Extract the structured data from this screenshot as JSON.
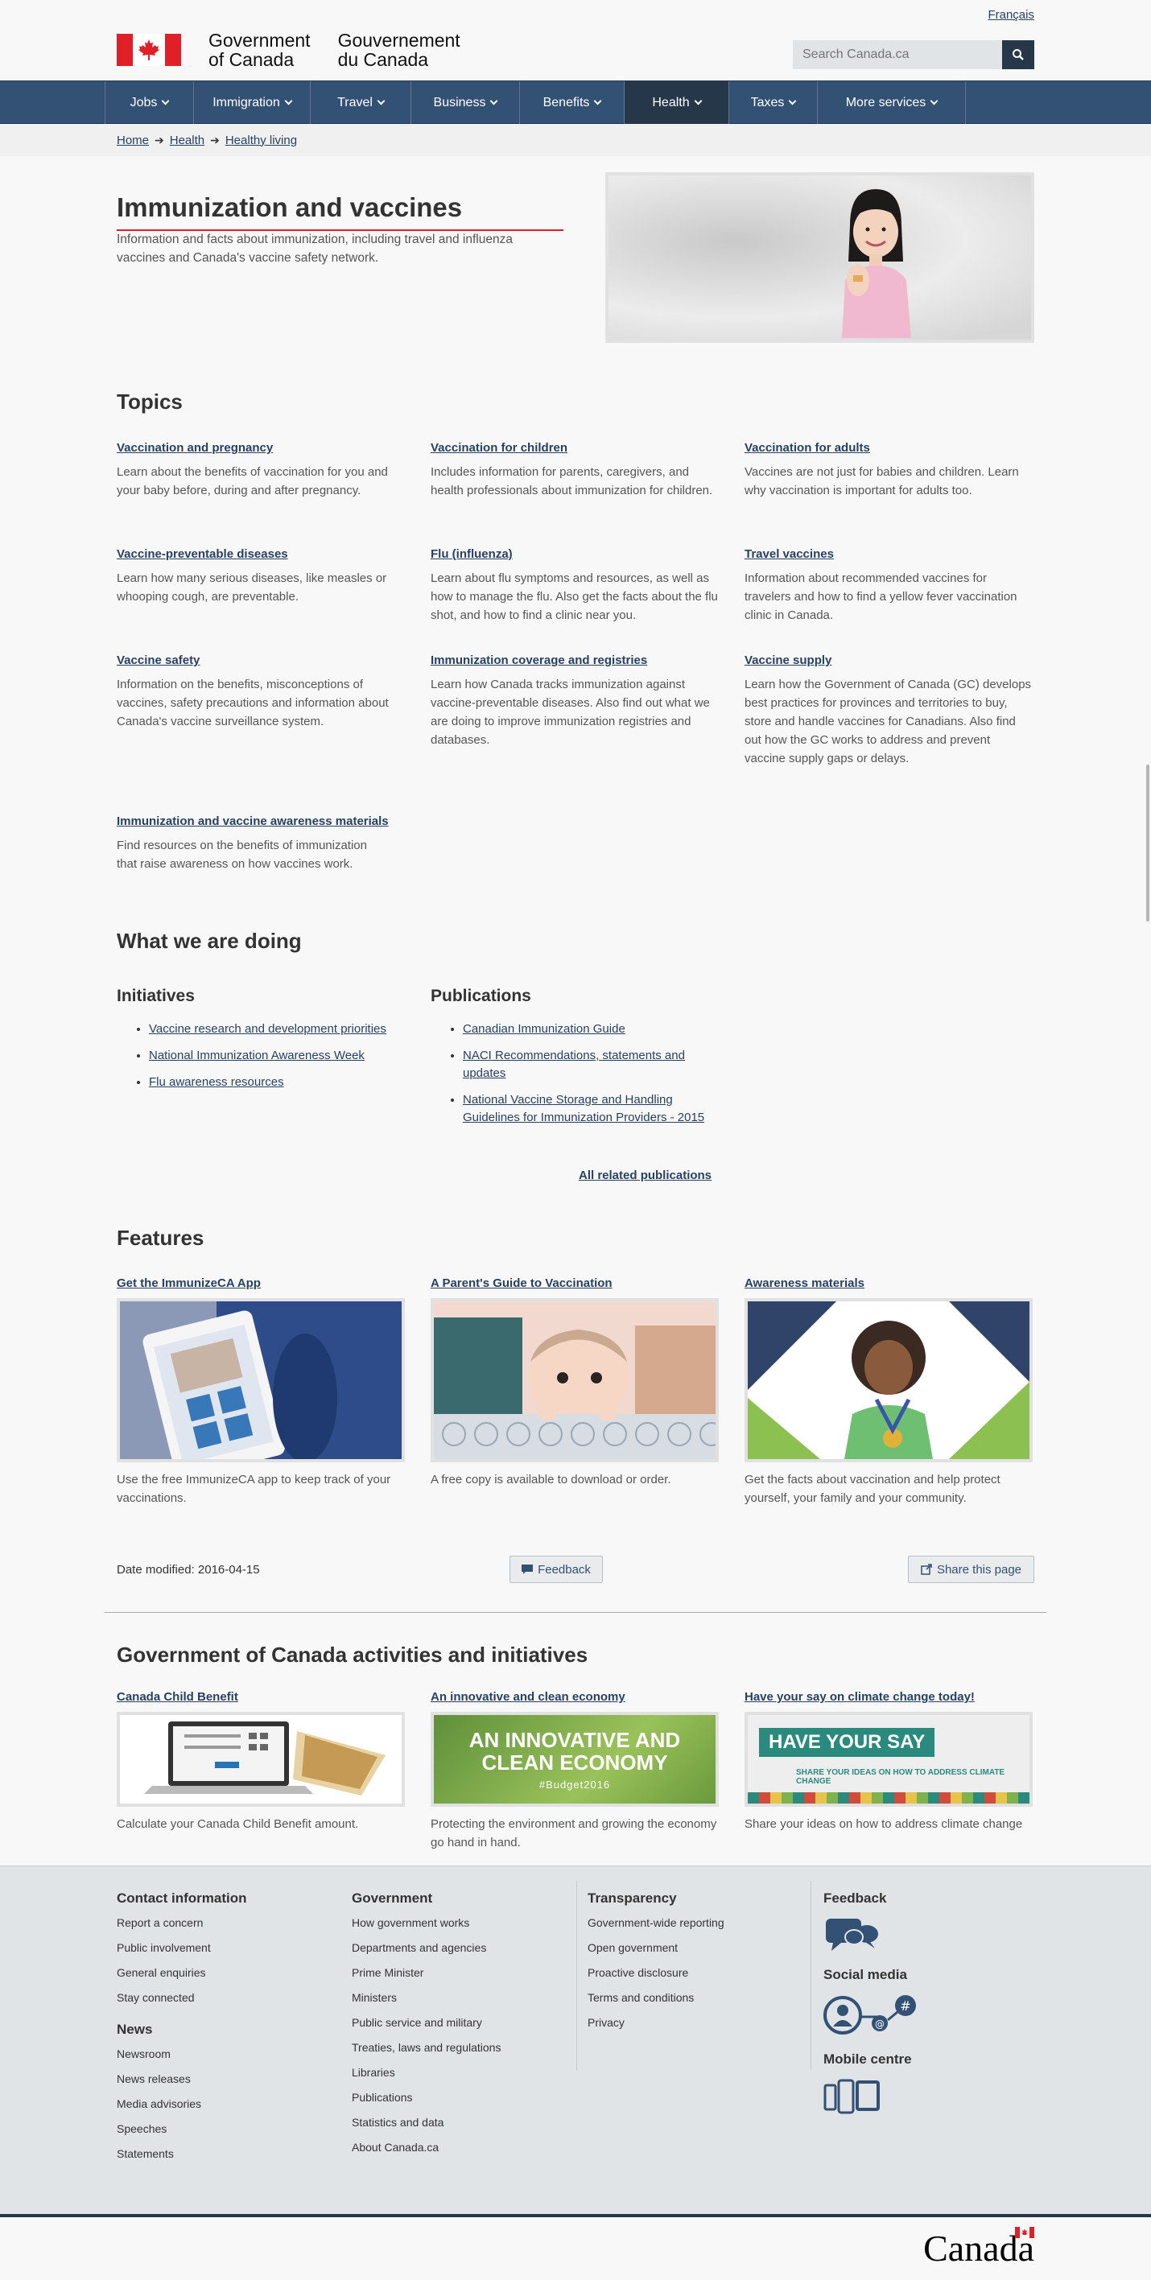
{
  "header": {
    "lang_link": "Français",
    "gov_en": [
      "Government",
      "of Canada"
    ],
    "gov_fr": [
      "Gouvernement",
      "du Canada"
    ],
    "search_placeholder": "Search Canada.ca"
  },
  "nav": [
    "Jobs",
    "Immigration",
    "Travel",
    "Business",
    "Benefits",
    "Health",
    "Taxes",
    "More services"
  ],
  "breadcrumb": [
    "Home",
    "Health",
    "Healthy living"
  ],
  "hero": {
    "title": "Immunization and vaccines",
    "desc": "Information and facts about immunization, including travel and influenza vaccines and Canada's vaccine safety network."
  },
  "topics": {
    "heading": "Topics",
    "items": [
      {
        "title": "Vaccination and pregnancy",
        "desc": "Learn about the benefits of vaccination for you and your baby before, during and after pregnancy."
      },
      {
        "title": "Vaccination for children",
        "desc": "Includes information for parents, caregivers, and health professionals about immunization for children."
      },
      {
        "title": "Vaccination for adults",
        "desc": "Vaccines are not just for babies and children. Learn why vaccination is important for adults too."
      },
      {
        "title": "Vaccine-preventable diseases",
        "desc": "Learn how many serious diseases, like measles or whooping cough, are preventable."
      },
      {
        "title": "Flu (influenza)",
        "desc": "Learn about flu symptoms and resources, as well as how to manage the flu. Also get the facts about the flu shot, and how to find a clinic near you."
      },
      {
        "title": "Travel vaccines",
        "desc": "Information about recommended vaccines for travelers and how to find a yellow fever vaccination clinic in Canada."
      },
      {
        "title": "Vaccine safety",
        "desc": "Information on the benefits, misconceptions of vaccines, safety precautions and information about Canada's vaccine surveillance system."
      },
      {
        "title": "Immunization coverage and registries",
        "desc": "Learn how Canada tracks immunization against vaccine-preventable diseases. Also find out what we are doing to improve immunization registries and databases."
      },
      {
        "title": "Vaccine supply",
        "desc": "Learn how the Government of Canada (GC) develops best practices for provinces and territories to buy, store and handle vaccines for Canadians. Also find out how the GC works to address and prevent vaccine supply gaps or delays."
      },
      {
        "title": "Immunization and vaccine awareness materials",
        "desc": "Find resources on the benefits of immunization that raise awareness on how vaccines work."
      }
    ]
  },
  "doing": {
    "heading": "What we are doing",
    "initiatives_heading": "Initiatives",
    "initiatives": [
      "Vaccine research and development priorities",
      "National Immunization Awareness Week",
      "Flu awareness resources"
    ],
    "publications_heading": "Publications",
    "publications": [
      "Canadian Immunization Guide",
      "NACI Recommendations, statements and updates",
      "National Vaccine Storage and Handling Guidelines for Immunization Providers - 2015"
    ],
    "all_publications": "All related publications"
  },
  "features": {
    "heading": "Features",
    "items": [
      {
        "title": "Get the ImmunizeCA App",
        "desc": "Use the free ImmunizeCA app to keep track of your vaccinations."
      },
      {
        "title": "A Parent's Guide to Vaccination",
        "desc": "A free copy is available to download or order."
      },
      {
        "title": "Awareness materials",
        "desc": "Get the facts about vaccination and help protect yourself, your family and your community."
      }
    ]
  },
  "meta": {
    "date_modified": "Date modified: 2016-04-15",
    "feedback": "Feedback",
    "share": "Share this page"
  },
  "gc_activities": {
    "heading": "Government of Canada activities and initiatives",
    "items": [
      {
        "title": "Canada Child Benefit",
        "desc": "Calculate your Canada Child Benefit amount."
      },
      {
        "title": "An innovative and clean economy",
        "desc": "Protecting the environment and growing the economy go hand in hand.",
        "banner_line1": "AN INNOVATIVE AND",
        "banner_line2": "CLEAN ECONOMY",
        "banner_tag": "#Budget2016"
      },
      {
        "title": "Have your say on climate change today!",
        "desc": "Share your ideas on how to address climate change",
        "banner_title": "HAVE YOUR SAY",
        "banner_sub": "SHARE YOUR IDEAS ON HOW TO ADDRESS CLIMATE CHANGE"
      }
    ]
  },
  "footer": {
    "contact_heading": "Contact information",
    "contact": [
      "Report a concern",
      "Public involvement",
      "General enquiries",
      "Stay connected"
    ],
    "news_heading": "News",
    "news": [
      "Newsroom",
      "News releases",
      "Media advisories",
      "Speeches",
      "Statements"
    ],
    "gov_heading": "Government",
    "gov": [
      "How government works",
      "Departments and agencies",
      "Prime Minister",
      "Ministers",
      "Public service and military",
      "Treaties, laws and regulations",
      "Libraries",
      "Publications",
      "Statistics and data",
      "About Canada.ca"
    ],
    "transparency_heading": "Transparency",
    "transparency": [
      "Government-wide reporting",
      "Open government",
      "Proactive disclosure",
      "Terms and conditions",
      "Privacy"
    ],
    "feedback_heading": "Feedback",
    "social_heading": "Social media",
    "mobile_heading": "Mobile centre",
    "wordmark": "Canada"
  }
}
